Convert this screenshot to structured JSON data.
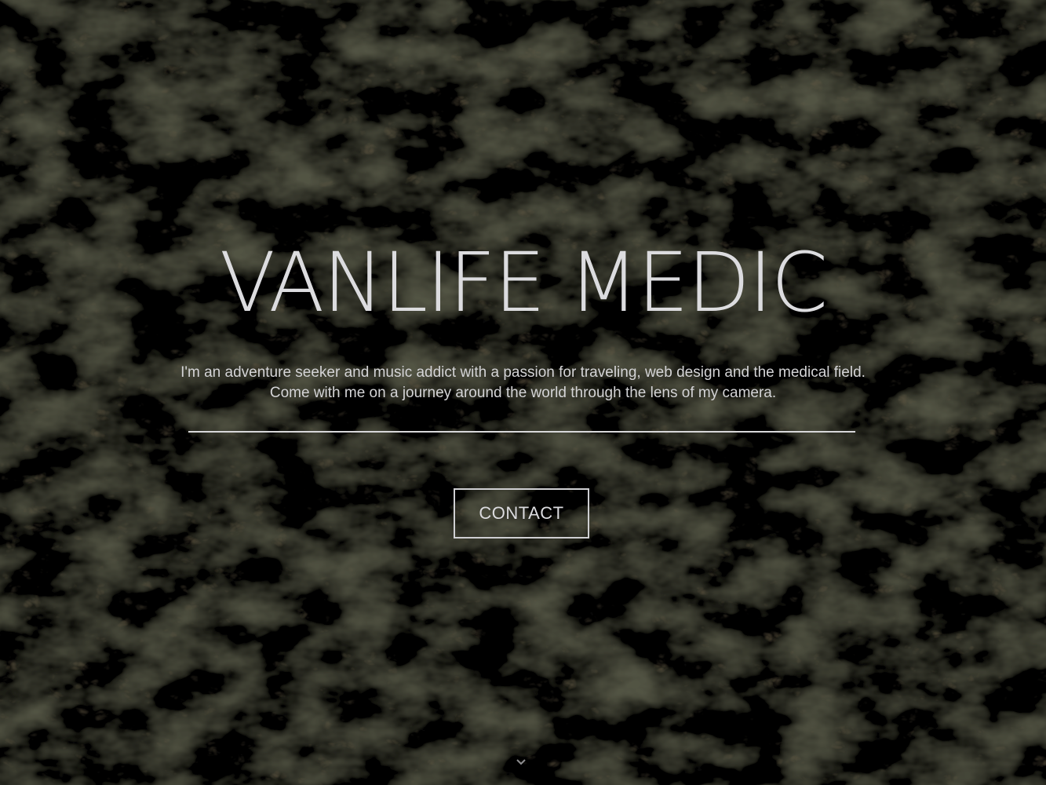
{
  "hero": {
    "title": "VANLIFE MEDIC",
    "tagline": "I'm an adventure seeker and music addict with a passion for traveling, web design and the medical field. Come with me on a journey around the world through the lens of my camera.",
    "contact_label": "CONTACT",
    "scroll_icon": "chevron-down-icon"
  },
  "colors": {
    "text": "#dcdcdf",
    "background": "#14140f"
  }
}
